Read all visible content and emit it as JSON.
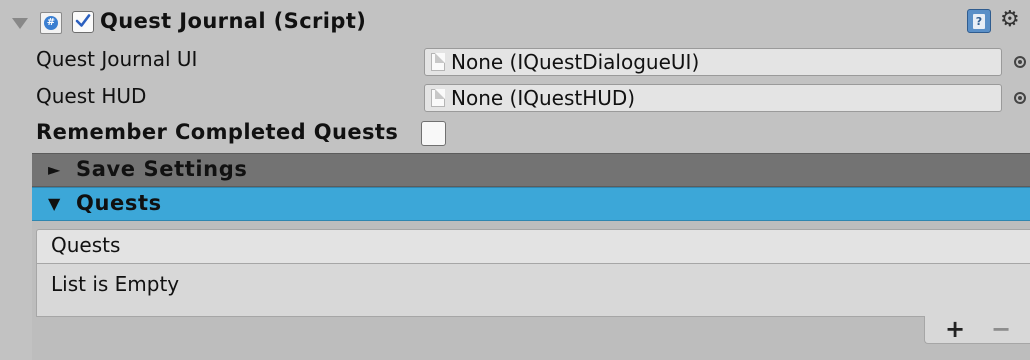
{
  "component": {
    "title": "Quest Journal (Script)",
    "enabled": true,
    "icons": [
      "foldout-arrow-icon",
      "csharp-script-icon",
      "help-icon",
      "gear-icon"
    ]
  },
  "properties": [
    {
      "label": "Quest Journal UI",
      "value": "None (IQuestDialogueUI)"
    },
    {
      "label": "Quest HUD",
      "value": "None (IQuestHUD)"
    }
  ],
  "remember_completed": {
    "label": "Remember Completed Quests",
    "checked": false
  },
  "sections": {
    "save_settings": {
      "arrow": "►",
      "title": "Save Settings",
      "expanded": false
    },
    "quests": {
      "arrow": "▼",
      "title": "Quests",
      "expanded": true
    }
  },
  "list": {
    "header": "Quests",
    "empty_text": "List is Empty",
    "add_label": "+",
    "remove_label": "−"
  },
  "colors": {
    "inspector_bg": "#c2c2c2",
    "section_collapsed": "#737373",
    "section_selected": "#3ca7d8"
  }
}
